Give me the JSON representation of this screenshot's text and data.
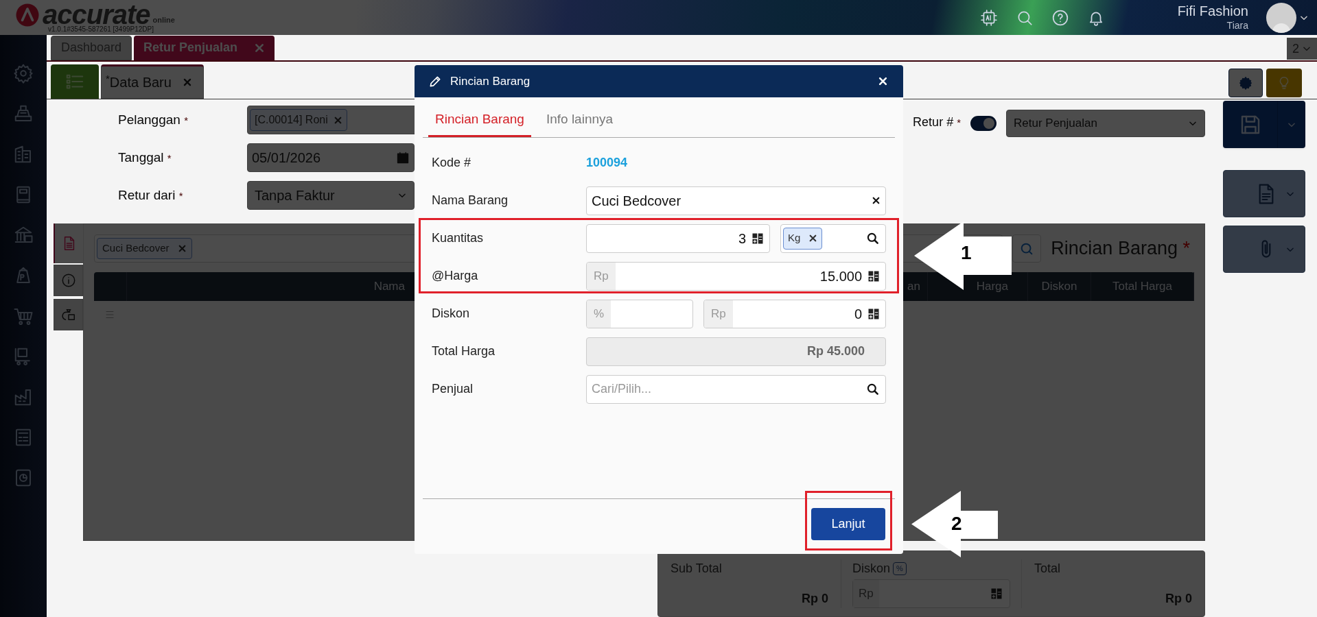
{
  "header": {
    "brand": "accurate",
    "brand_suffix": "online",
    "version": "v1.0.1#3545-587261 [3499P12DP]",
    "company": "Fifi Fashion",
    "user": "Tiara"
  },
  "tabs": [
    {
      "label": "Dashboard",
      "selected": false,
      "closable": false
    },
    {
      "label": "Retur Penjualan",
      "selected": true,
      "closable": true
    }
  ],
  "tab_count": "2",
  "document_tab": {
    "label": "$^{*}$Data Baru"
  },
  "form": [
    {
      "label": "Pelanggan",
      "mark": "*",
      "kind": "tag",
      "value": "[C.00014] Roni"
    },
    {
      "label": "Tanggal",
      "mark": "*",
      "kind": "date",
      "value": "05/01/2026"
    },
    {
      "label": "Retur dari",
      "mark": "*",
      "kind": "select",
      "value": "Tanpa Faktur"
    }
  ],
  "retur_number": {
    "label": "Retur #",
    "mark": "*",
    "auto": true,
    "value": "Retur Penjualan"
  },
  "detail": {
    "item_tags": [
      "Cuci Bedcover"
    ],
    "title": "Rincian Barang",
    "mark": "*",
    "columns": [
      "Nama",
      "an",
      "Harga",
      "Diskon",
      "Total Harga"
    ]
  },
  "totals": {
    "subtotal_label": "Sub Total",
    "subtotal": "Rp 0",
    "discount_label": "Diskon",
    "discount_mode": "%",
    "discount_placeholder": "Rp",
    "total_label": "Total",
    "total": "Rp 0"
  },
  "modal": {
    "title": "Rincian Barang",
    "tabs": [
      {
        "label": "Rincian Barang",
        "selected": true
      },
      {
        "label": "Info lainnya",
        "selected": false
      }
    ],
    "rows": [
      {
        "kind": "code",
        "label": "Kode #",
        "value": "100094"
      },
      {
        "kind": "clearable",
        "label": "Nama Barang",
        "value": "Cuci Bedcover"
      },
      {
        "kind": "quantity",
        "label": "Kuantitas",
        "value": "3",
        "unit": "Kg"
      },
      {
        "kind": "money",
        "label": "@Harga",
        "prefix": "Rp",
        "value": "15.000"
      },
      {
        "kind": "discount",
        "label": "Diskon",
        "percent_prefix": "%",
        "prefix": "Rp",
        "value": "0"
      },
      {
        "kind": "readonly",
        "label": "Total Harga",
        "value": "Rp 45.000"
      },
      {
        "kind": "search",
        "label": "Penjual",
        "placeholder": "Cari/Pilih..."
      }
    ],
    "button": "Lanjut"
  },
  "callouts": [
    {
      "label": "1"
    },
    {
      "label": "2"
    }
  ]
}
